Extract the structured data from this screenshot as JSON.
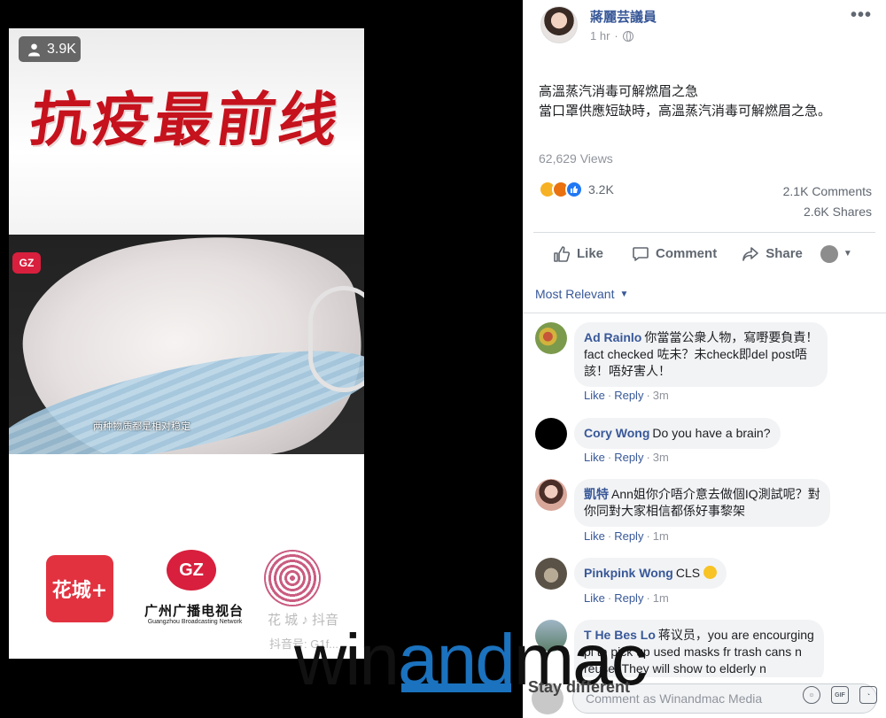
{
  "video": {
    "viewer_count": "3.9K",
    "headline": "抗疫最前线",
    "subtitle": "两种物质都是相对稳定",
    "badge_small": "GZ",
    "logo_huacheng": "花城+",
    "logo_gz_mark": "GZ",
    "logo_gz_cn": "广州广播电视台",
    "logo_gz_en": "Guangzhou Broadcasting Network",
    "tiktok_label": "花 城 ♪ 抖音",
    "tiktok_id": "抖音号: G1f..."
  },
  "post": {
    "author": "蔣麗芸議員",
    "time": "1 hr",
    "title": "高溫蒸汽消毒可解燃眉之急",
    "body": "當口罩供應短缺時，高溫蒸汽消毒可解燃眉之急。",
    "views": "62,629 Views",
    "reaction_count": "3.2K",
    "comments_count": "2.1K Comments",
    "shares_count": "2.6K Shares",
    "actions": {
      "like": "Like",
      "comment": "Comment",
      "share": "Share"
    },
    "sort_label": "Most Relevant"
  },
  "comments": [
    {
      "name": "Ad Rainlo",
      "lines": [
        "你當當公衆人物，寫嘢要負責！",
        "fact checked 咗未？未check即del post唔",
        "該！唔好害人！"
      ],
      "like": "Like",
      "reply": "Reply",
      "time": "3m",
      "avatar_color": "#7b9a4c"
    },
    {
      "name": "Cory Wong",
      "lines": [
        "Do you have a brain?"
      ],
      "like": "Like",
      "reply": "Reply",
      "time": "3m",
      "avatar_color": "#000000"
    },
    {
      "name": "凱特",
      "lines": [
        "Ann姐你介唔介意去做個IQ測試呢？對",
        "你同對大家相信都係好事黎架"
      ],
      "like": "Like",
      "reply": "Reply",
      "time": "1m",
      "avatar_color": "#d8a79a"
    },
    {
      "name": "Pinkpink Wong",
      "lines": [
        "CLS"
      ],
      "like": "Like",
      "reply": "Reply",
      "time": "1m",
      "avatar_color": "#8a8170"
    },
    {
      "name": "T He Bes Lo",
      "lines": [
        "蒋议员，you are encourging",
        "pl to pick up used masks fr trash cans n",
        "reuse! They will show to elderly n"
      ],
      "avatar_color": "#5c7f6a"
    }
  ],
  "composer": {
    "placeholder": "Comment as Winandmac Media"
  },
  "watermark": {
    "part1": "win",
    "part2": "and",
    "part3": "mac",
    "tagline": "Stay different"
  }
}
